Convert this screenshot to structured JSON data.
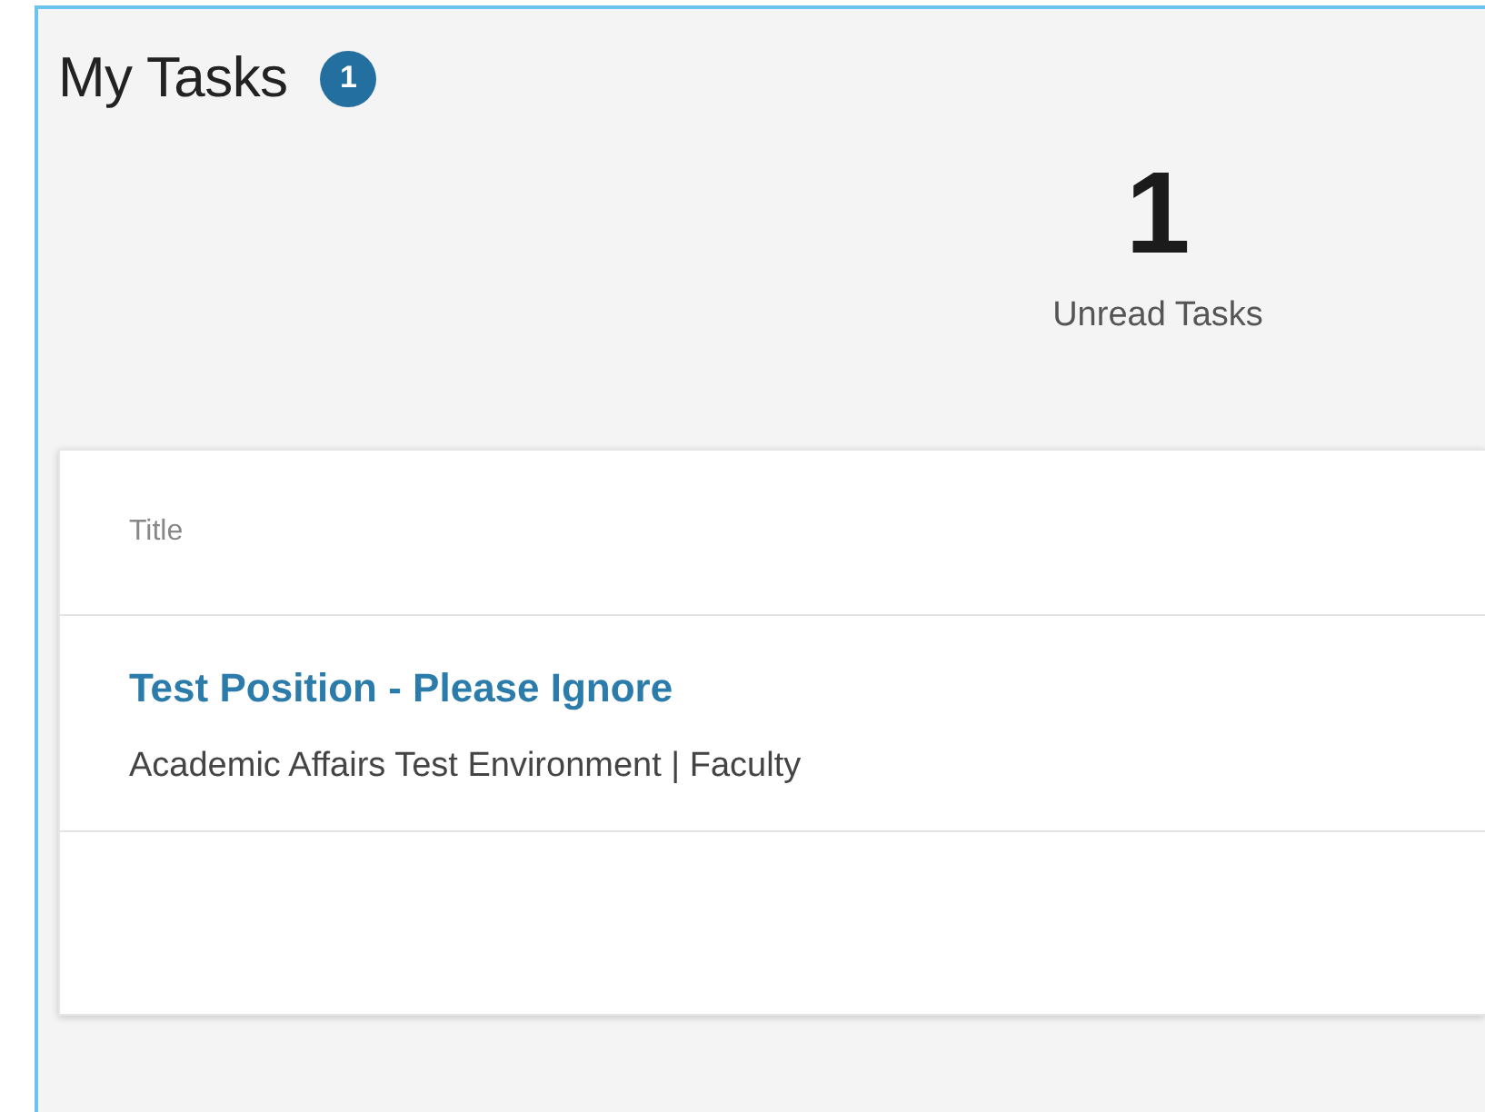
{
  "header": {
    "title": "My Tasks",
    "badge": "1"
  },
  "summary": {
    "count": "1",
    "label": "Unread Tasks"
  },
  "table": {
    "columns": [
      "Title"
    ],
    "rows": [
      {
        "title": "Test Position - Please Ignore",
        "subtitle": "Academic Affairs Test Environment | Faculty"
      }
    ]
  }
}
